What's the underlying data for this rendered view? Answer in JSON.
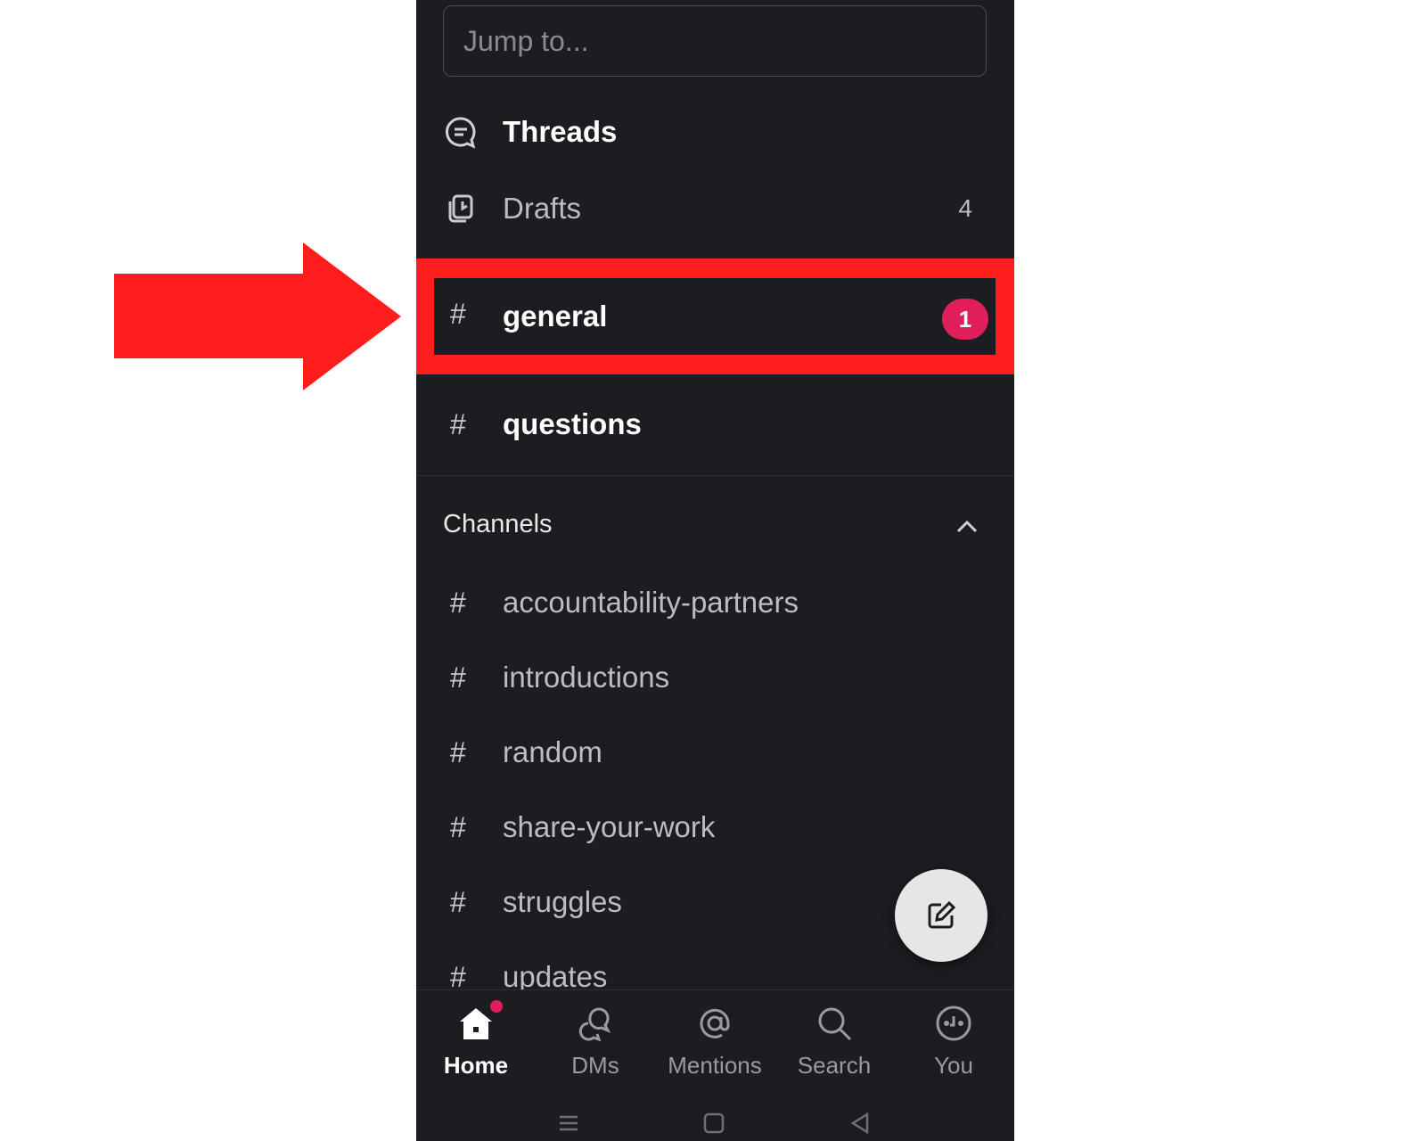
{
  "search": {
    "placeholder": "Jump to..."
  },
  "nav": {
    "threads": {
      "label": "Threads"
    },
    "drafts": {
      "label": "Drafts",
      "count": "4"
    }
  },
  "highlighted_channel": {
    "hash": "#",
    "label": "general",
    "badge": "1"
  },
  "unsectioned": [
    {
      "hash": "#",
      "label": "questions"
    }
  ],
  "channels": {
    "title": "Channels",
    "items": [
      {
        "hash": "#",
        "label": "accountability-partners"
      },
      {
        "hash": "#",
        "label": "introductions"
      },
      {
        "hash": "#",
        "label": "random"
      },
      {
        "hash": "#",
        "label": "share-your-work"
      },
      {
        "hash": "#",
        "label": "struggles"
      },
      {
        "hash": "#",
        "label": "updates"
      }
    ]
  },
  "tabs": [
    {
      "label": "Home",
      "icon": "home-icon",
      "active": true
    },
    {
      "label": "DMs",
      "icon": "dms-icon"
    },
    {
      "label": "Mentions",
      "icon": "mentions-icon"
    },
    {
      "label": "Search",
      "icon": "search-icon"
    },
    {
      "label": "You",
      "icon": "you-icon"
    }
  ],
  "colors": {
    "highlight": "#ff1d1d",
    "badge": "#e01e5a",
    "background": "#1c1d21"
  }
}
